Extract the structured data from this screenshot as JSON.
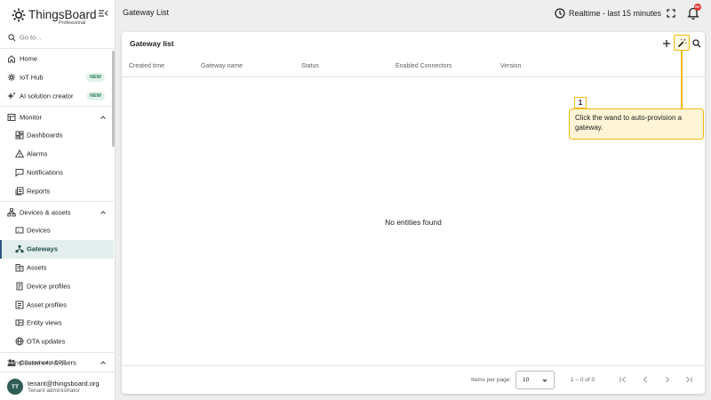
{
  "brand": {
    "name": "ThingsBoard",
    "edition": "Professional"
  },
  "search": {
    "placeholder": "Go to..."
  },
  "sidebar": {
    "items": [
      {
        "label": "Home"
      },
      {
        "label": "IoT Hub",
        "badge": "NEW"
      },
      {
        "label": "AI solution creator",
        "badge": "NEW"
      },
      {
        "label": "Monitor"
      },
      {
        "label": "Dashboards"
      },
      {
        "label": "Alarms"
      },
      {
        "label": "Notifications"
      },
      {
        "label": "Reports"
      },
      {
        "label": "Devices & assets"
      },
      {
        "label": "Devices"
      },
      {
        "label": "Gateways"
      },
      {
        "label": "Assets"
      },
      {
        "label": "Device profiles"
      },
      {
        "label": "Asset profiles"
      },
      {
        "label": "Entity views"
      },
      {
        "label": "OTA updates"
      },
      {
        "label": "Customers & users"
      }
    ],
    "active": "Gateways",
    "version": "ThingsBoard v.4.4.0PE"
  },
  "user": {
    "initials": "TT",
    "email": "tenant@thingsboard.org",
    "role": "Tenant administrator"
  },
  "topbar": {
    "title": "Gateway List",
    "timewindow": "Realtime - last 15 minutes",
    "notifications_badge": "99+"
  },
  "card": {
    "title": "Gateway list",
    "columns": [
      "Created time",
      "Gateway name",
      "Status",
      "Enabled Connectors",
      "Version"
    ],
    "empty_message": "No entities found"
  },
  "paginator": {
    "label": "Items per page:",
    "page_size": "10",
    "range": "1 – 0 of 0"
  },
  "guide": {
    "step": "1",
    "text": "Click the wand to auto-provision a gateway."
  },
  "colors": {
    "accent": "#305680",
    "active_bg": "#e3eeec",
    "highlight": "#f2b90f",
    "tooltip_bg": "#fff4d6"
  }
}
